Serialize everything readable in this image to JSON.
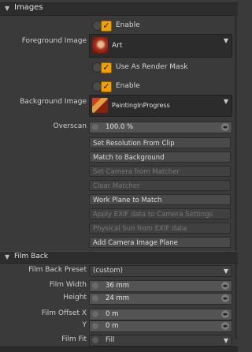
{
  "images": {
    "section_title": "Images",
    "fg_enable_label": "Enable",
    "fg_label": "Foreground Image",
    "fg_image_name": "Art",
    "render_mask_label": "Use As Render Mask",
    "bg_enable_label": "Enable",
    "bg_label": "Background Image",
    "bg_image_name": "PaintingInProgress",
    "overscan_label": "Overscan",
    "overscan_value": "100.0 %",
    "buttons": [
      "Set Resolution From Clip",
      "Match to Background",
      "Set Camera from Matcher",
      "Clear Matcher",
      "Work Plane to Match",
      "Apply EXIF data to Camera Settings",
      "Physical Sun from EXIF data",
      "Add Camera Image Plane"
    ]
  },
  "filmback": {
    "section_title": "Film Back",
    "preset_label": "Film Back Preset",
    "preset_value": "(custom)",
    "width_label": "Film Width",
    "width_value": "36 mm",
    "height_label": "Height",
    "height_value": "24 mm",
    "offx_label": "Film Offset X",
    "offx_value": "0 m",
    "offy_label": "Y",
    "offy_value": "0 m",
    "fit_label": "Film Fit",
    "fit_value": "Fill"
  },
  "colors": {
    "accent": "#f0a000"
  }
}
